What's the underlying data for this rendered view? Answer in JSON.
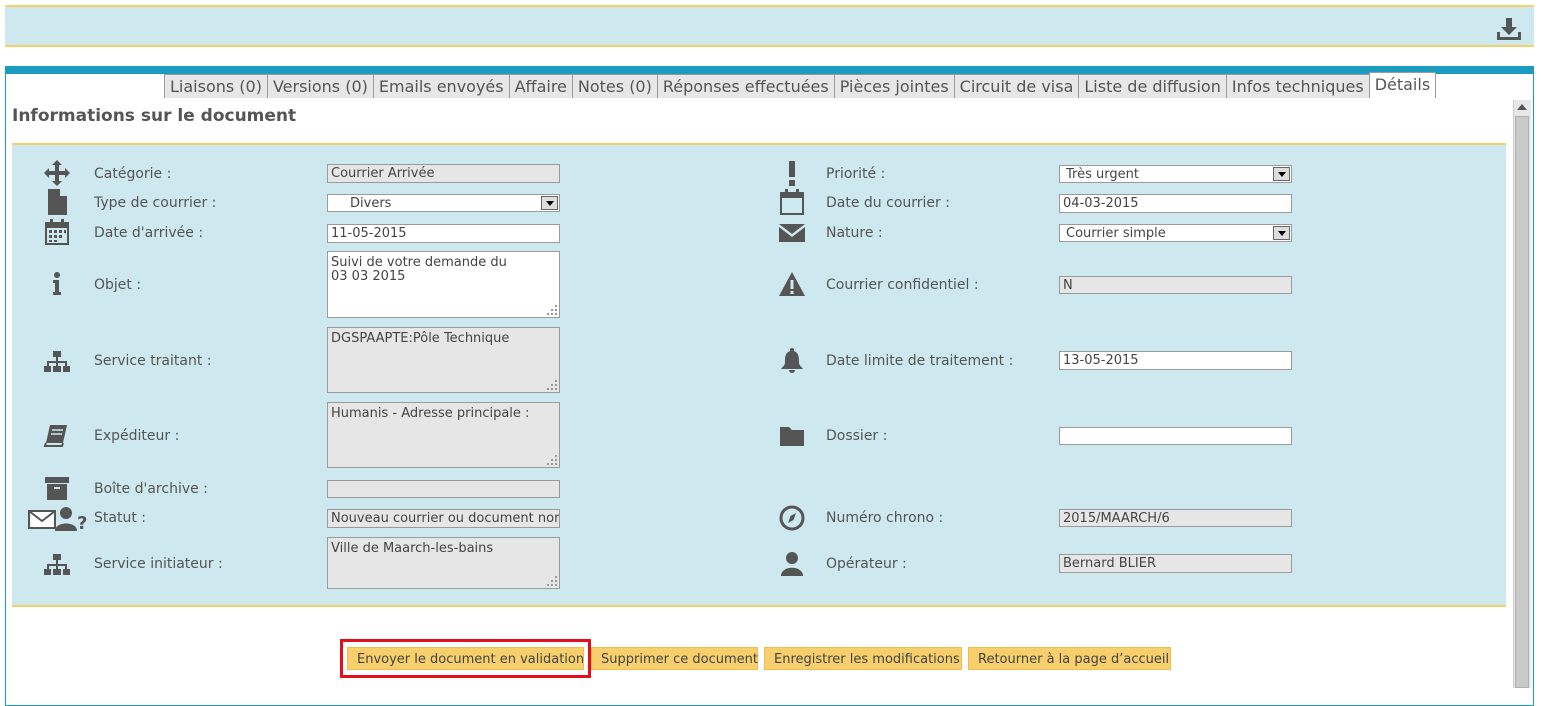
{
  "tabs": [
    {
      "label": "Liaisons (0)"
    },
    {
      "label": "Versions (0)"
    },
    {
      "label": "Emails envoyés"
    },
    {
      "label": "Affaire"
    },
    {
      "label": "Notes (0)"
    },
    {
      "label": "Réponses effectuées"
    },
    {
      "label": "Pièces jointes"
    },
    {
      "label": "Circuit de visa"
    },
    {
      "label": "Liste de diffusion"
    },
    {
      "label": "Infos techniques"
    },
    {
      "label": "Détails"
    }
  ],
  "active_tab": "Détails",
  "section_title": "Informations sur le document",
  "left": {
    "categorie": {
      "label": "Catégorie :",
      "value": "Courrier Arrivée",
      "icon": "move-icon"
    },
    "type_courrier": {
      "label": "Type de courrier :",
      "value": "Divers",
      "icon": "file-icon"
    },
    "date_arrivee": {
      "label": "Date d'arrivée :",
      "value": "11-05-2015",
      "icon": "calendar-icon"
    },
    "objet": {
      "label": "Objet :",
      "value": "Suivi de votre demande du 03 03 2015",
      "icon": "info-icon"
    },
    "service_traitant": {
      "label": "Service traitant :",
      "value": "DGSPAAPTE:Pôle Technique",
      "icon": "org-chart-icon"
    },
    "expediteur": {
      "label": "Expéditeur :",
      "value": "Humanis - Adresse principale :",
      "icon": "book-icon"
    },
    "boite_archive": {
      "label": "Boîte d'archive :",
      "value": "",
      "icon": "archive-icon"
    },
    "statut": {
      "label": "Statut :",
      "value": "Nouveau courrier ou document non",
      "icon": "mail-user-question-icon"
    },
    "service_initiateur": {
      "label": "Service initiateur :",
      "value": "Ville de Maarch-les-bains",
      "icon": "org-chart-icon"
    }
  },
  "right": {
    "priorite": {
      "label": "Priorité :",
      "value": "Très urgent",
      "icon": "exclamation-icon"
    },
    "date_courrier": {
      "label": "Date du courrier :",
      "value": "04-03-2015",
      "icon": "calendar-empty-icon"
    },
    "nature": {
      "label": "Nature :",
      "value": "Courrier simple",
      "icon": "envelope-icon"
    },
    "confidentiel": {
      "label": "Courrier confidentiel :",
      "value": "N",
      "icon": "warning-icon"
    },
    "date_limite": {
      "label": "Date limite de traitement :",
      "value": "13-05-2015",
      "icon": "bell-icon"
    },
    "dossier": {
      "label": "Dossier :",
      "value": "",
      "icon": "folder-icon"
    },
    "numero_chrono": {
      "label": "Numéro chrono :",
      "value": "2015/MAARCH/6",
      "icon": "compass-icon"
    },
    "operateur": {
      "label": "Opérateur :",
      "value": "Bernard BLIER",
      "icon": "user-icon"
    }
  },
  "buttons": {
    "validate": "Envoyer le document en validation",
    "delete": "Supprimer ce document",
    "save": "Enregistrer les modifications",
    "home": "Retourner à la page d’accueil"
  },
  "colors": {
    "panel": "#cde8ee",
    "accent": "#f6cf6a",
    "frame": "#1b9bbf",
    "button": "#f8cf6d",
    "highlight": "#e3101b"
  }
}
